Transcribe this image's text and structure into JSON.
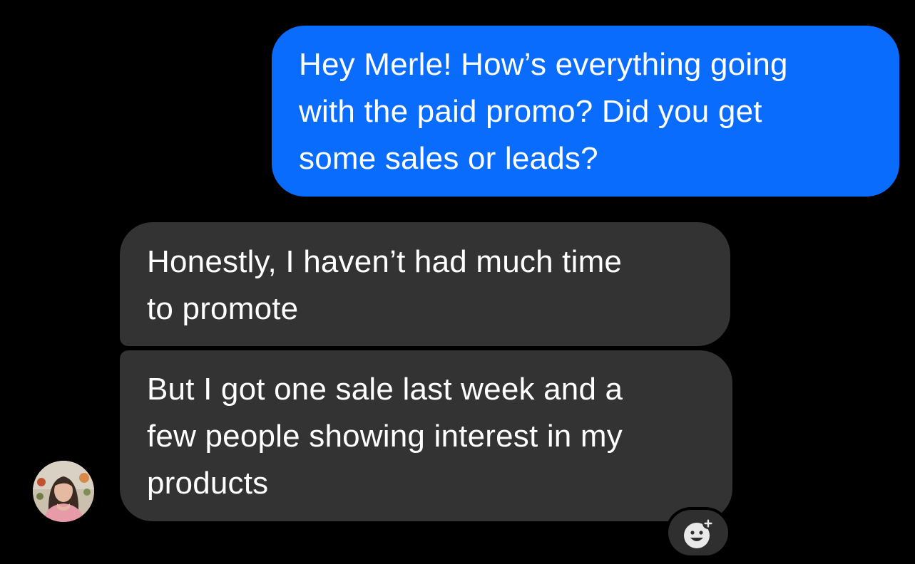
{
  "conversation": {
    "messages": [
      {
        "direction": "sent",
        "text": "Hey Merle! How’s everything going\nwith the paid promo? Did you get\nsome sales or leads?"
      },
      {
        "direction": "received",
        "text": "Honestly, I haven’t had much time\nto promote"
      },
      {
        "direction": "received",
        "text": "But I got one sale last week and a\nfew people showing interest in my\nproducts"
      }
    ]
  },
  "contact": {
    "avatar_icon": "profile-photo"
  },
  "reaction_button": {
    "icon": "add-reaction-icon"
  },
  "colors": {
    "background": "#000000",
    "sent_bubble": "#0a6cfc",
    "received_bubble": "#333333",
    "text": "#ffffff"
  }
}
